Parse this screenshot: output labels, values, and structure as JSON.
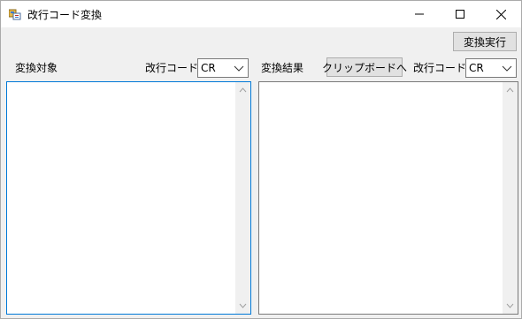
{
  "window": {
    "title": "改行コード変換",
    "icons": {
      "app": "app-icon",
      "minimize": "minimize-icon",
      "maximize": "maximize-icon",
      "close": "close-icon"
    }
  },
  "toolbar": {
    "execute_label": "変換実行"
  },
  "source": {
    "label": "変換対象",
    "code_label": "改行コード",
    "code_value": "CR",
    "text": ""
  },
  "result": {
    "label": "変換結果",
    "clipboard_label": "クリップボードへ",
    "code_label": "改行コード",
    "code_value": "CR",
    "text": ""
  },
  "colors": {
    "focus_border": "#0078d7",
    "button_bg": "#e1e1e1",
    "window_bg": "#f0f0f0"
  }
}
